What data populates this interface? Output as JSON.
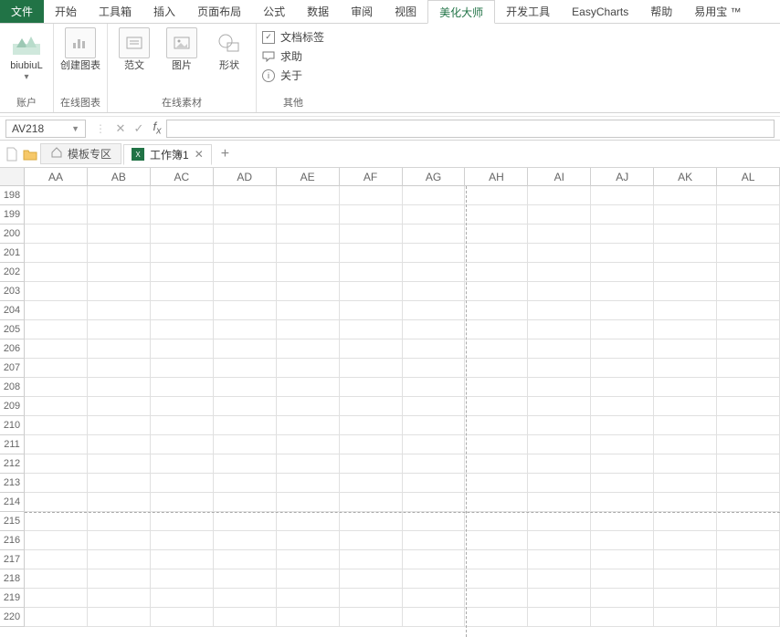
{
  "tabs": {
    "file": "文件",
    "items": [
      "开始",
      "工具箱",
      "插入",
      "页面布局",
      "公式",
      "数据",
      "审阅",
      "视图",
      "美化大师",
      "开发工具",
      "EasyCharts",
      "帮助",
      "易用宝 ™"
    ],
    "activeIndex": 8
  },
  "ribbon": {
    "account": {
      "btn": "biubiuL",
      "sub": "▾",
      "group": "账户"
    },
    "onlineChart": {
      "btn": "创建图表",
      "group": "在线图表"
    },
    "onlineAssets": {
      "items": [
        "范文",
        "图片",
        "形状"
      ],
      "group": "在线素材"
    },
    "other": {
      "items": [
        "文档标签",
        "求助",
        "关于"
      ],
      "group": "其他"
    }
  },
  "nameBox": {
    "value": "AV218"
  },
  "formulaBar": {
    "value": ""
  },
  "sheetTabs": {
    "template": "模板专区",
    "workbook": "工作簿1"
  },
  "grid": {
    "columns": [
      "AA",
      "AB",
      "AC",
      "AD",
      "AE",
      "AF",
      "AG",
      "AH",
      "AI",
      "AJ",
      "AK",
      "AL"
    ],
    "rowStart": 198,
    "rowEnd": 220,
    "pageBreakAfterCol": "AG",
    "pageBreakAfterRow": 214
  }
}
